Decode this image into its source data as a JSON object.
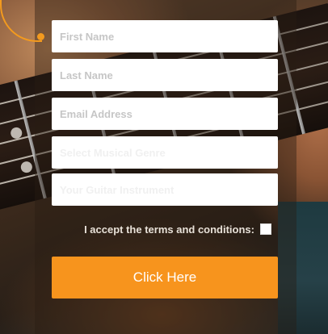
{
  "form": {
    "fields": [
      {
        "placeholder": "First Name"
      },
      {
        "placeholder": "Last Name"
      },
      {
        "placeholder": "Email Address"
      },
      {
        "placeholder": "Select Musical Genre"
      },
      {
        "placeholder": "Your Guitar Instrument"
      }
    ],
    "terms_label": "I accept the terms and conditions:",
    "terms_checked": false,
    "submit_label": "Click Here"
  },
  "colors": {
    "accent": "#f7941d",
    "field_bg": "#ffffff",
    "placeholder": "#c6c6c6",
    "label": "#e8e1d8"
  },
  "icons": [
    "decorative-curve-dot-icon"
  ]
}
